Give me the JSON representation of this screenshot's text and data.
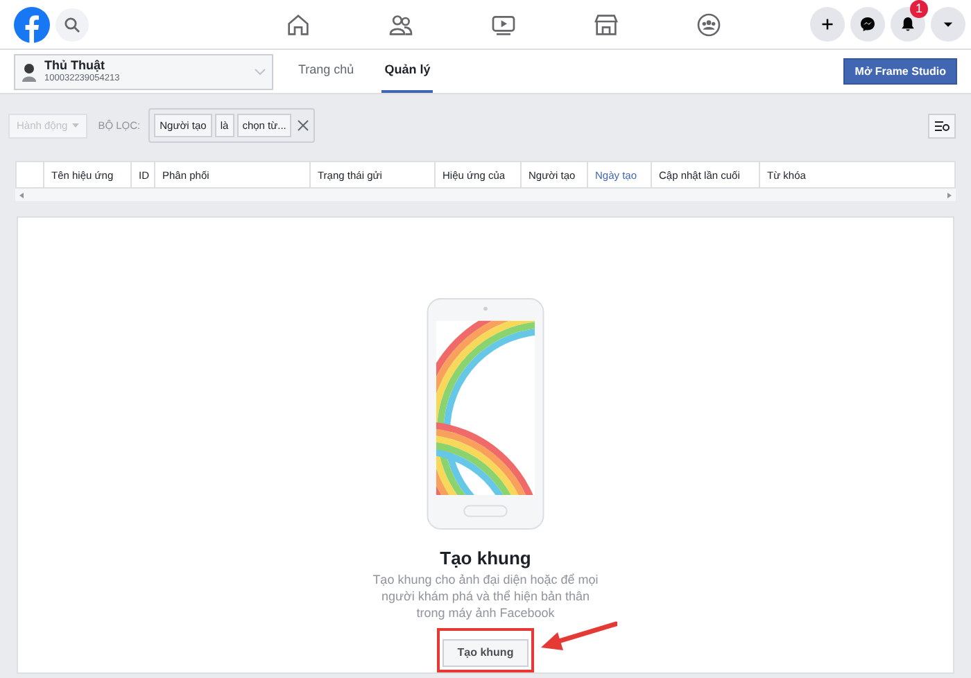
{
  "topbar": {
    "nav_icons": [
      {
        "kind": "home",
        "selected": false
      },
      {
        "kind": "friends",
        "selected": false
      },
      {
        "kind": "video",
        "selected": false
      },
      {
        "kind": "store",
        "selected": false
      },
      {
        "kind": "groups",
        "selected": false
      }
    ],
    "actions": [
      {
        "kind": "plus"
      },
      {
        "kind": "messenger"
      },
      {
        "kind": "bell",
        "badge": "1"
      },
      {
        "kind": "caret"
      }
    ]
  },
  "page_selector": {
    "name": "Thủ Thuật",
    "id": "100032239054213"
  },
  "tabs": [
    {
      "label": "Trang chủ",
      "selected": false
    },
    {
      "label": "Quản lý",
      "selected": true
    }
  ],
  "open_studio_button": "Mở Frame Studio",
  "filter_bar": {
    "action_button": {
      "label": "Hành động",
      "disabled": true
    },
    "filter_label": "BỘ LỌC:",
    "filter_tokens": [
      "Người tạo",
      "là",
      "chọn từ..."
    ]
  },
  "table": {
    "columns": [
      {
        "label": "Tên hiệu ứng",
        "sorted": false
      },
      {
        "label": "ID",
        "sorted": false
      },
      {
        "label": "Phân phối",
        "sorted": false
      },
      {
        "label": "Trạng thái gửi",
        "sorted": false
      },
      {
        "label": "Hiệu ứng của",
        "sorted": false
      },
      {
        "label": "Người tạo",
        "sorted": false
      },
      {
        "label": "Ngày tạo",
        "sorted": true
      },
      {
        "label": "Cập nhật lần cuối",
        "sorted": false
      },
      {
        "label": "Từ khóa",
        "sorted": false
      }
    ]
  },
  "empty_state": {
    "title": "Tạo khung",
    "description": "Tạo khung cho ảnh đại diện hoặc để mọi người khám phá và thể hiện bản thân trong máy ảnh Facebook",
    "button": "Tạo khung",
    "highlighted": true
  }
}
